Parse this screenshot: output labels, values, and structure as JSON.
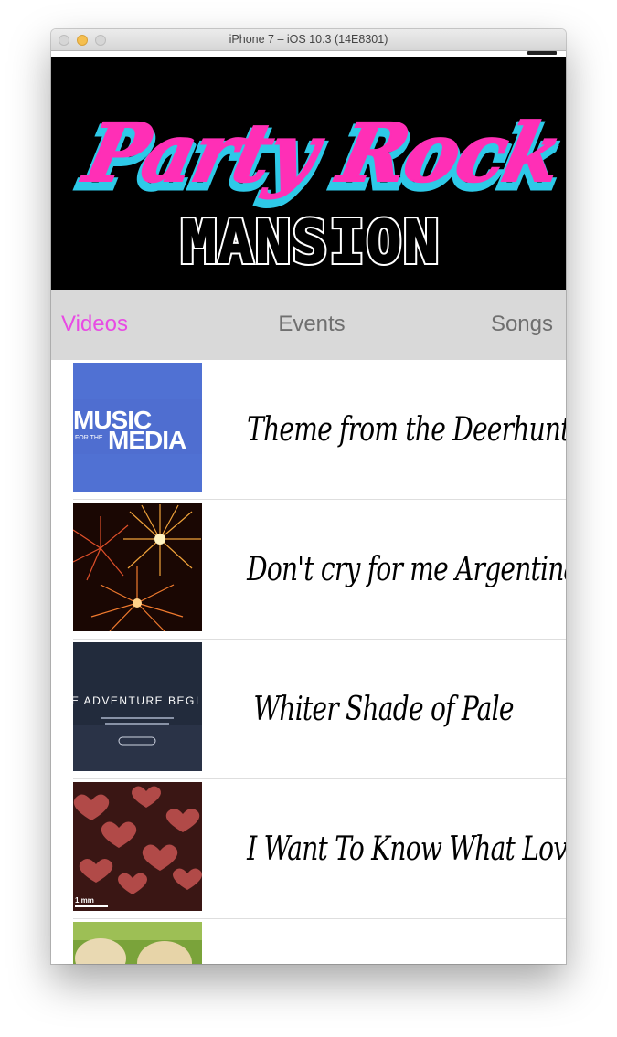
{
  "window": {
    "title": "iPhone 7 – iOS 10.3 (14E8301)"
  },
  "banner": {
    "line1": "Party Rock",
    "line2": "MANSION"
  },
  "segments": [
    {
      "label": "Videos",
      "selected": true
    },
    {
      "label": "Events",
      "selected": false
    },
    {
      "label": "Songs",
      "selected": false
    }
  ],
  "colors": {
    "accent": "#e84be4",
    "segment_bg": "#d9d9d9",
    "banner_pink": "#ff2fb6",
    "banner_cyan": "#2ec9e8"
  },
  "videos": [
    {
      "title": "Theme from the Deerhunter",
      "thumb": {
        "kind": "text",
        "line1": "MUSIC",
        "line2": "FOR THE",
        "line3": "MEDIA"
      }
    },
    {
      "title": "Don't cry for me Argentina",
      "thumb": {
        "kind": "fireworks"
      }
    },
    {
      "title": "Whiter Shade of Pale",
      "thumb": {
        "kind": "night",
        "text": "E ADVENTURE BEGI"
      }
    },
    {
      "title": "I Want To Know What Love Is",
      "thumb": {
        "kind": "hearts",
        "scale": "1 mm"
      }
    },
    {
      "title": "",
      "thumb": {
        "kind": "grass"
      }
    }
  ]
}
